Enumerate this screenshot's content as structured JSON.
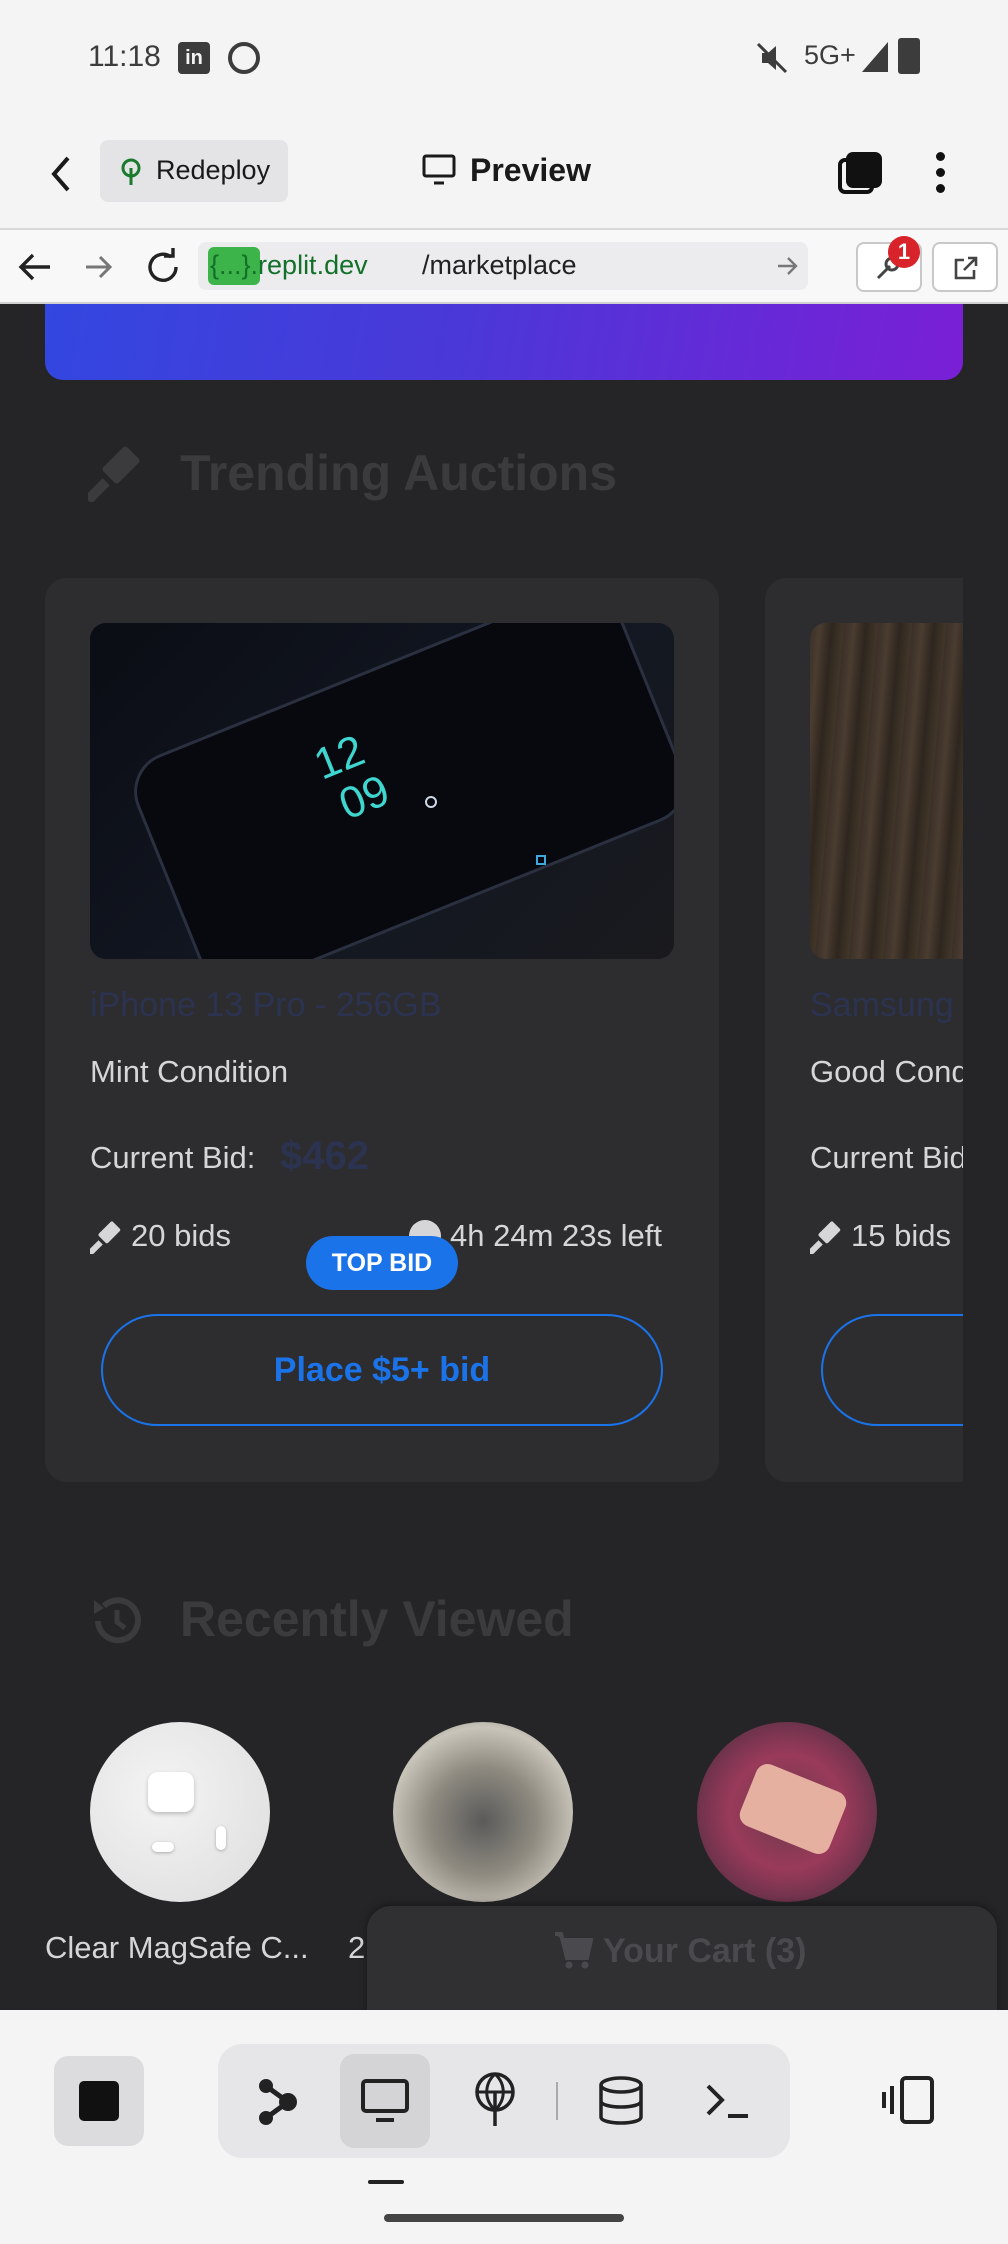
{
  "status_bar": {
    "time": "11:18",
    "network": "5G+"
  },
  "topbar": {
    "redeploy_label": "Redeploy",
    "preview_label": "Preview"
  },
  "urlbar": {
    "domain": "{...}.replit.dev",
    "path": "/marketplace",
    "badge_count": "1"
  },
  "page": {
    "trending_title": "Trending Auctions",
    "cards": [
      {
        "title": "iPhone 13 Pro - 256GB",
        "condition": "Mint Condition",
        "bid_label": "Current Bid:",
        "bid_value": "$462",
        "bids": "20 bids",
        "time_left": "4h 24m 23s left",
        "badge": "TOP BID",
        "button": "Place $5+ bid"
      },
      {
        "title": "Samsung",
        "condition": "Good Cond",
        "bid_label": "Current Bid",
        "bids": "15 bids"
      }
    ],
    "recent_title": "Recently Viewed",
    "recent_items": [
      {
        "label": "Clear MagSafe C..."
      },
      {
        "label": "2"
      },
      {
        "label": ""
      }
    ],
    "cart_label": "Your Cart (3)"
  },
  "colors": {
    "accent": "#1a73e8",
    "gradient_start": "#3d4ee6",
    "gradient_end": "#7a1fd6"
  }
}
